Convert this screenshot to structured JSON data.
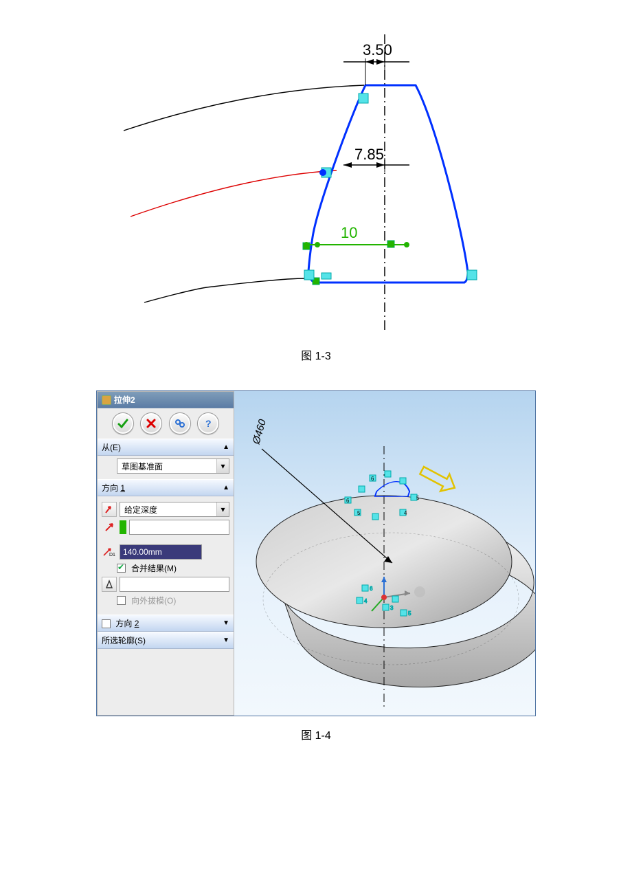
{
  "fig13": {
    "caption": "图 1-3",
    "dims": {
      "top": "3.50",
      "mid": "7.85",
      "base": "10"
    }
  },
  "fig14": {
    "caption": "图 1-4",
    "panel_title": "拉伸2",
    "section_from": {
      "label": "从(E)",
      "selected": "草图基准面"
    },
    "section_dir1": {
      "label": "方向 1",
      "end_condition": "给定深度",
      "depth_value": "140.00mm",
      "merge_result": "合并结果(M)",
      "draft_outward": "向外拔模(O)"
    },
    "section_dir2": {
      "label": "方向 2"
    },
    "section_sel": {
      "label": "所选轮廓(S)"
    },
    "view_dim": {
      "diameter": "Ø460"
    }
  }
}
